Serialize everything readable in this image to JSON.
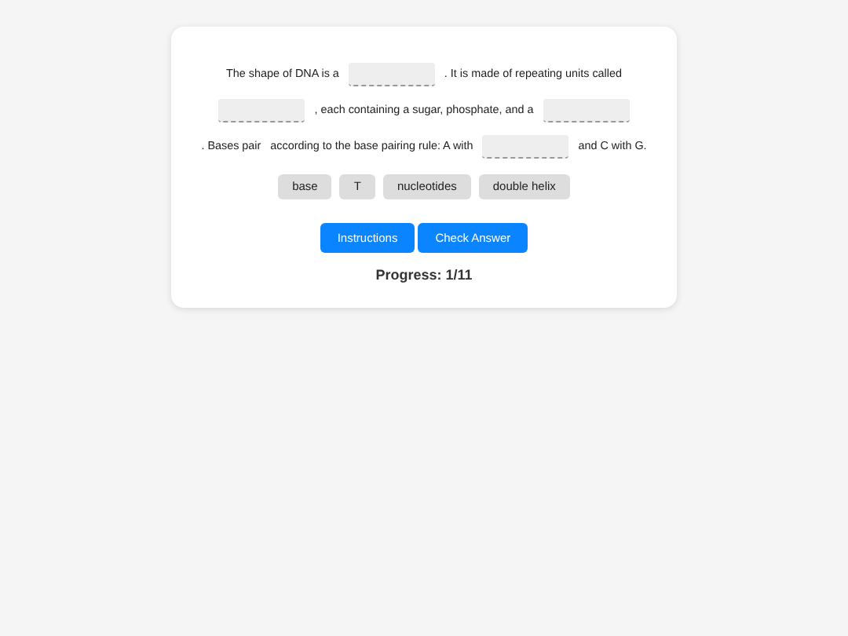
{
  "passage": [
    {
      "kind": "text",
      "text": "The shape of DNA is a"
    },
    {
      "kind": "blank"
    },
    {
      "kind": "text",
      "text": ". It is made of repeating units called"
    },
    {
      "kind": "blank"
    },
    {
      "kind": "text",
      "text": ", each containing a sugar, phosphate, and a"
    },
    {
      "kind": "blank"
    },
    {
      "kind": "text",
      "text": ". Bases pair"
    },
    {
      "kind": "text",
      "text": "according to the base pairing rule: A with"
    },
    {
      "kind": "blank"
    },
    {
      "kind": "text",
      "text": "and C with G."
    }
  ],
  "word_bank": [
    "base",
    "T",
    "nucleotides",
    "double helix"
  ],
  "buttons": [
    "Instructions",
    "Check Answer"
  ],
  "progress": "Progress: 1/11"
}
